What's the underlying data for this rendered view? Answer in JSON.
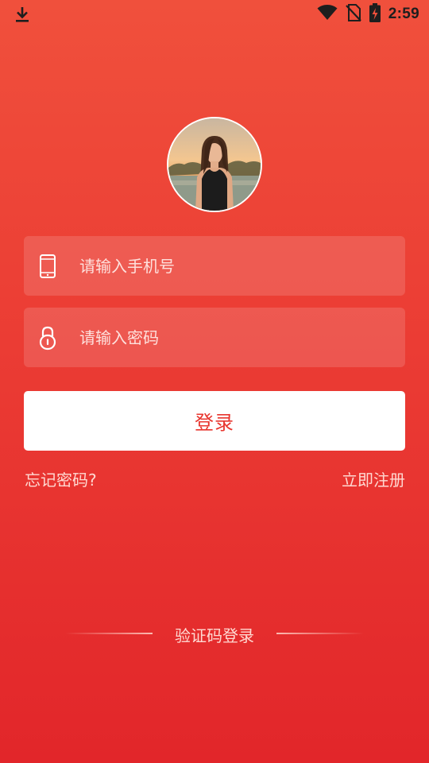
{
  "status_bar": {
    "time": "2:59",
    "icons": [
      "download-icon",
      "wifi-icon",
      "no-sim-icon",
      "battery-charging-icon"
    ]
  },
  "avatar": {
    "icon": "user-photo"
  },
  "form": {
    "phone_placeholder": "请输入手机号",
    "phone_icon": "phone-icon",
    "phone_value": "",
    "password_placeholder": "请输入密码",
    "password_icon": "lock-icon",
    "password_value": "",
    "login_label": "登录"
  },
  "links": {
    "forgot_password": "忘记密码?",
    "register": "立即注册"
  },
  "alt_login": {
    "label": "验证码登录"
  },
  "colors": {
    "background_top": "#f0503c",
    "background_bottom": "#e2262a",
    "accent": "#e8352e",
    "button_bg": "#ffffff",
    "link_text": "#ffd9d2"
  }
}
